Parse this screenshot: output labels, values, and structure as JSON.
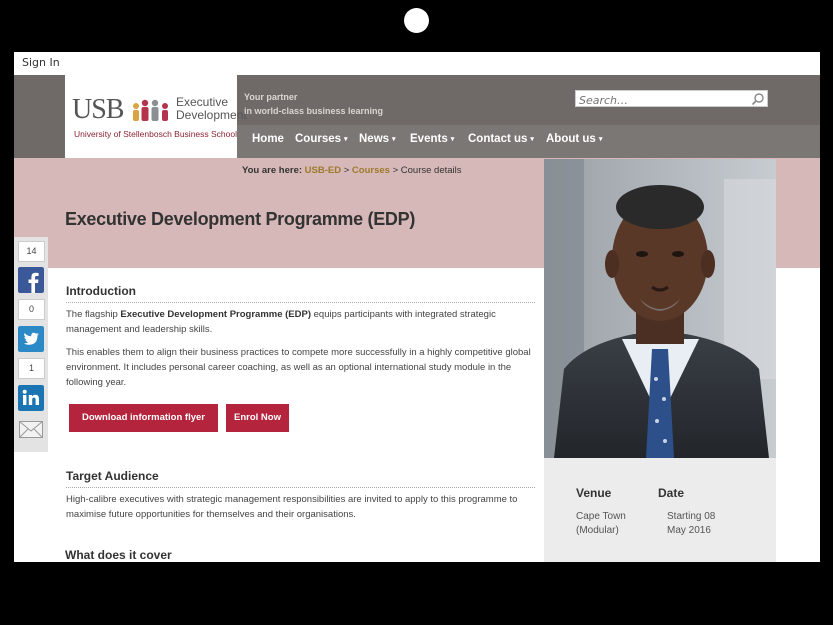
{
  "header": {
    "sign_in": "Sign In",
    "logo_usb": "USB",
    "logo_exec_line1": "Executive",
    "logo_exec_line2": "Development",
    "logo_sub": "University of Stellenbosch Business School",
    "tagline_1": "Your partner",
    "tagline_2": "in world-class business learning",
    "search_placeholder": "Search…"
  },
  "nav": {
    "items": [
      "Home",
      "Courses",
      "News",
      "Events",
      "Contact us",
      "About us"
    ],
    "caret": "▾"
  },
  "breadcrumb": {
    "prefix": "You are here:",
    "crumb1": "USB-ED",
    "sep": ">",
    "crumb2": "Courses",
    "crumb3": "Course details"
  },
  "page": {
    "title": "Executive Development Programme (EDP)"
  },
  "intro": {
    "heading": "Introduction",
    "p1_pre": "The flagship ",
    "p1_bold": "Executive Development Programme (EDP)",
    "p1_post": " equips participants with integrated strategic management and leadership skills.",
    "p2": "This enables them to align their business practices to compete more successfully in a highly competitive global environment. It includes personal career coaching, as well as an optional international study module in the following year."
  },
  "buttons": {
    "download": "Download information flyer",
    "enrol": "Enrol Now"
  },
  "audience": {
    "heading": "Target Audience",
    "text": "High-calibre executives with strategic management responsibilities are invited to apply to this programme to maximise future opportunities for themselves and their organisations."
  },
  "cover": {
    "heading": "What does it cover"
  },
  "info": {
    "venue_label": "Venue",
    "venue_line1": "Cape Town",
    "venue_line2": "(Modular)",
    "date_label": "Date",
    "date_line1": "Starting 08",
    "date_line2": "May 2016"
  },
  "share": {
    "facebook_count": "14",
    "twitter_count": "0",
    "linkedin_count": "1",
    "facebook_color": "#3b5998",
    "twitter_color": "#2b8ac6",
    "linkedin_color": "#1c75b3"
  },
  "icons": [
    "search-icon",
    "facebook-icon",
    "twitter-icon",
    "linkedin-icon",
    "email-icon"
  ]
}
